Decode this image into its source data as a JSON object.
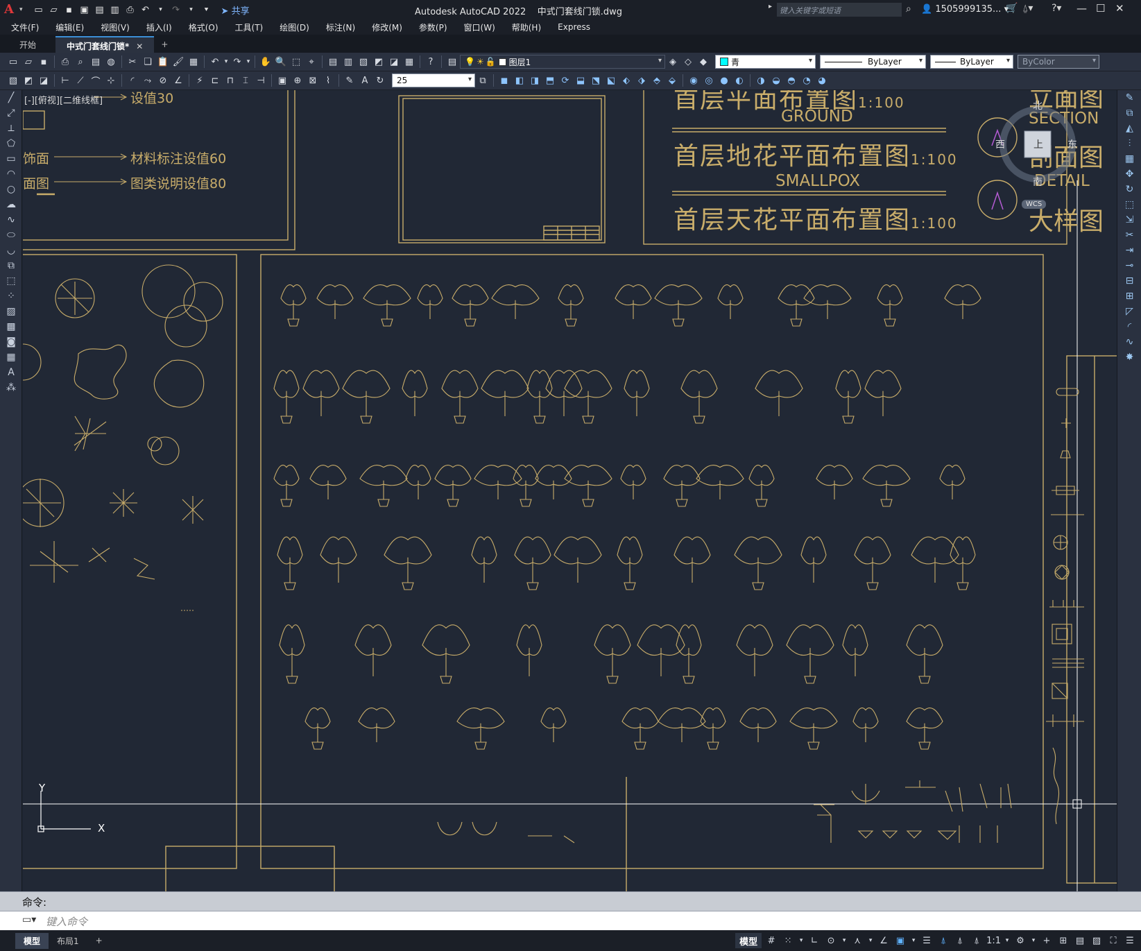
{
  "app": {
    "logo": "A",
    "title": "Autodesk AutoCAD 2022",
    "filename": "中式门套线门锁.dwg",
    "share_label": "共享",
    "search_placeholder": "键入关键字或短语",
    "user": "1505999135..."
  },
  "menu": [
    "文件(F)",
    "编辑(E)",
    "视图(V)",
    "插入(I)",
    "格式(O)",
    "工具(T)",
    "绘图(D)",
    "标注(N)",
    "修改(M)",
    "参数(P)",
    "窗口(W)",
    "帮助(H)",
    "Express"
  ],
  "tabs": {
    "start": "开始",
    "active": "中式门套线门锁*",
    "close": "✕",
    "add": "+"
  },
  "properties": {
    "layer": "图层1",
    "color": "青",
    "color_swatch": "#00ffff",
    "linetype": "ByLayer",
    "lineweight": "ByLayer",
    "plotstyle": "ByColor",
    "dim_value": "25"
  },
  "viewport_label": "[-][俯视][二维线框]",
  "annotations": {
    "note1": "设值30",
    "note2_left": "饰面",
    "note2": "材料标注设值60",
    "note3_left": "面图",
    "note3": "图类说明设值80",
    "title_cn_1": "首层平面布置图",
    "scale1": "1:100",
    "title_en_1": "GROUND",
    "title_cn_2": "首层地花平面布置图",
    "scale2": "1:100",
    "title_en_2": "SMALLPOX",
    "title_cn_3": "首层天花平面布置图",
    "scale3": "1:100",
    "right_cn_1": "立面图",
    "right_en_1": "SECTION",
    "right_cn_2": "剖面图",
    "right_en_2": "DETAIL",
    "right_cn_3": "大样图"
  },
  "viewcube": {
    "north": "北",
    "south": "南",
    "east": "东",
    "west": "西",
    "top": "上",
    "wcs": "WCS"
  },
  "ucs": {
    "x": "X",
    "y": "Y"
  },
  "command": {
    "history": "命令:",
    "placeholder": "键入命令"
  },
  "status": {
    "model_tab": "模型",
    "layout_tab": "布局1",
    "add": "+",
    "mode": "模型",
    "scale": "1:1"
  },
  "colors": {
    "background": "#212835",
    "drawing": "#c9ad6a",
    "ui_dark": "#1b1f27",
    "accent": "#3c8fd6"
  }
}
